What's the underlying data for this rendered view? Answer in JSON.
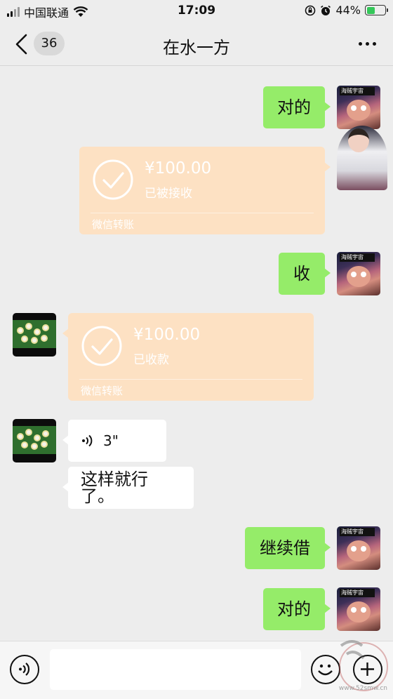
{
  "status_bar": {
    "carrier": "中国联通",
    "time": "17:09",
    "battery": "44%"
  },
  "nav": {
    "unread_count": "36",
    "title": "在水一方"
  },
  "messages": [
    {
      "side": "right",
      "kind": "text",
      "text": "对的"
    },
    {
      "side": "right",
      "kind": "transfer",
      "amount": "¥100.00",
      "status": "已被接收",
      "footer": "微信转账"
    },
    {
      "side": "right",
      "kind": "text",
      "text": "收"
    },
    {
      "side": "left",
      "kind": "transfer",
      "amount": "¥100.00",
      "status": "已收款",
      "footer": "微信转账"
    },
    {
      "side": "left",
      "kind": "voice",
      "duration": "3\""
    },
    {
      "side": "left",
      "kind": "text",
      "text": "这样就行了。"
    },
    {
      "side": "right",
      "kind": "text",
      "text": "继续借"
    },
    {
      "side": "right",
      "kind": "text",
      "text": "对的"
    }
  ],
  "avatar_self_badge": "海贼宇宙",
  "watermark": "www.52smw.cn",
  "colors": {
    "bubble_green": "#95ec69",
    "transfer_orange": "#fde1c3",
    "background": "#ededed"
  },
  "icons": [
    "chevron-left-icon",
    "more-icon",
    "voice-wave-icon",
    "check-circle-icon",
    "voice-mode-icon",
    "emoji-icon",
    "plus-circle-icon",
    "wifi-icon",
    "alarm-icon"
  ]
}
